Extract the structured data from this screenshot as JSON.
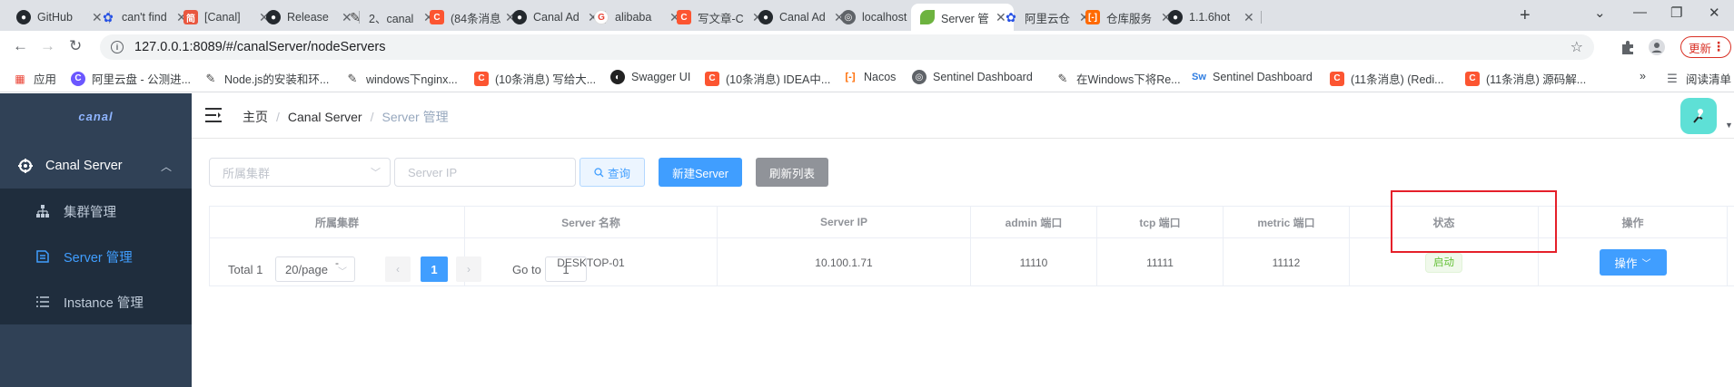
{
  "browser": {
    "tabs": [
      {
        "title": "GitHub",
        "icon": "github-icon"
      },
      {
        "title": "can't find",
        "icon": "paw-icon"
      },
      {
        "title": "[Canal]",
        "icon": "jianshu-icon"
      },
      {
        "title": "Release",
        "icon": "github-icon"
      },
      {
        "title": "2、canal",
        "icon": "pen-icon"
      },
      {
        "title": "(84条消息",
        "icon": "csdn-icon"
      },
      {
        "title": "Canal Ad",
        "icon": "github-icon"
      },
      {
        "title": "alibaba",
        "icon": "google-icon"
      },
      {
        "title": "写文章-C",
        "icon": "csdn-icon"
      },
      {
        "title": "Canal Ad",
        "icon": "github-icon"
      },
      {
        "title": "localhost",
        "icon": "globe-icon"
      },
      {
        "title": "Server 管",
        "icon": "spring-leaf-icon",
        "active": true
      },
      {
        "title": "阿里云仓",
        "icon": "paw-icon"
      },
      {
        "title": "仓库服务",
        "icon": "aliyun-icon"
      },
      {
        "title": "1.1.6hot",
        "icon": "github-icon"
      }
    ],
    "url": "127.0.0.1:8089/#/canalServer/nodeServers",
    "update_label": "更新",
    "bookmarks": [
      {
        "label": "应用",
        "icon": "apps-icon"
      },
      {
        "label": "阿里云盘 - 公测进...",
        "icon": "aliyun-drive-icon"
      },
      {
        "label": "Node.js的安装和环...",
        "icon": "pen-icon"
      },
      {
        "label": "windows下nginx...",
        "icon": "pen-icon"
      },
      {
        "label": "(10条消息) 写给大...",
        "icon": "csdn-icon"
      },
      {
        "label": "Swagger UI",
        "icon": "swagger-icon"
      },
      {
        "label": "(10条消息) IDEA中...",
        "icon": "csdn-icon"
      },
      {
        "label": "Nacos",
        "icon": "nacos-icon"
      },
      {
        "label": "Sentinel Dashboard",
        "icon": "globe-icon"
      },
      {
        "label": "在Windows下将Re...",
        "icon": "pen-icon"
      },
      {
        "label": "Sentinel Dashboard",
        "icon": "sentinel-icon"
      },
      {
        "label": "(11条消息) (Redi...",
        "icon": "csdn-icon"
      },
      {
        "label": "(11条消息) 源码解...",
        "icon": "csdn-icon"
      }
    ],
    "reading_list_label": "阅读清单",
    "colors": {
      "accent": "#409eff",
      "sidebar": "#304156",
      "submenu": "#1f2d3d"
    }
  },
  "sidebar": {
    "logo": "canal",
    "menu_title": "Canal Server",
    "items": [
      {
        "label": "集群管理",
        "icon": "cluster-icon"
      },
      {
        "label": "Server 管理",
        "icon": "server-icon",
        "active": true
      },
      {
        "label": "Instance 管理",
        "icon": "list-icon"
      }
    ]
  },
  "navbar": {
    "breadcrumb": [
      "主页",
      "Canal Server",
      "Server 管理"
    ]
  },
  "filters": {
    "cluster_placeholder": "所属集群",
    "ip_placeholder": "Server IP",
    "query_label": "查询",
    "new_label": "新建Server",
    "refresh_label": "刷新列表"
  },
  "table": {
    "headers": [
      "所属集群",
      "Server 名称",
      "Server IP",
      "admin 端口",
      "tcp 端口",
      "metric 端口",
      "状态",
      "操作"
    ],
    "rows": [
      {
        "cluster": "-",
        "name": "DESKTOP-01",
        "ip": "10.100.1.71",
        "admin_port": "11110",
        "tcp_port": "11111",
        "metric_port": "11112",
        "status": "启动",
        "action": "操作"
      }
    ]
  },
  "pagination": {
    "total": "Total 1",
    "page_size": "20/page",
    "current_page": "1",
    "goto_label": "Go to",
    "goto_value": "1"
  }
}
